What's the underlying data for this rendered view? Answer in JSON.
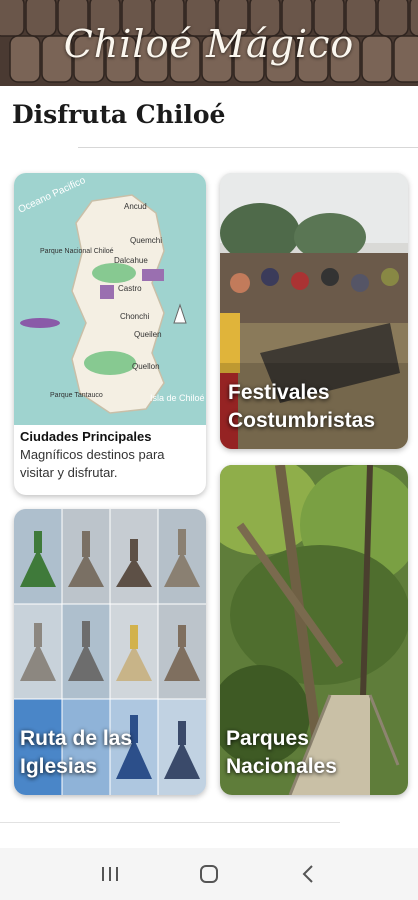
{
  "header": {
    "title": "Chiloé Mágico"
  },
  "section": {
    "title": "Disfruta Chiloé"
  },
  "cards": [
    {
      "title": "Ciudades Principales",
      "description": "Magníficos destinos para visitar y disfrutar."
    },
    {
      "title": "Festivales Costumbristas"
    },
    {
      "title": "Ruta de las Iglesias"
    },
    {
      "title": "Parques Nacionales"
    }
  ],
  "map": {
    "labels": [
      "Oceano Pacifico",
      "Ancud",
      "Quemchi",
      "Dalcahue",
      "Castro",
      "Chonchi",
      "Queilen",
      "Quellon",
      "Parque Nacional Chiloé",
      "Parque Tantauco",
      "Isla de Chiloé"
    ]
  },
  "navbar": {
    "recents_icon": "recents-icon",
    "home_icon": "home-icon",
    "back_icon": "back-icon"
  },
  "colors": {
    "banner": "#4a3a32",
    "map_sea": "#9fd3cf",
    "map_land": "#f4efe3",
    "title_text": "#1b1b1b"
  }
}
